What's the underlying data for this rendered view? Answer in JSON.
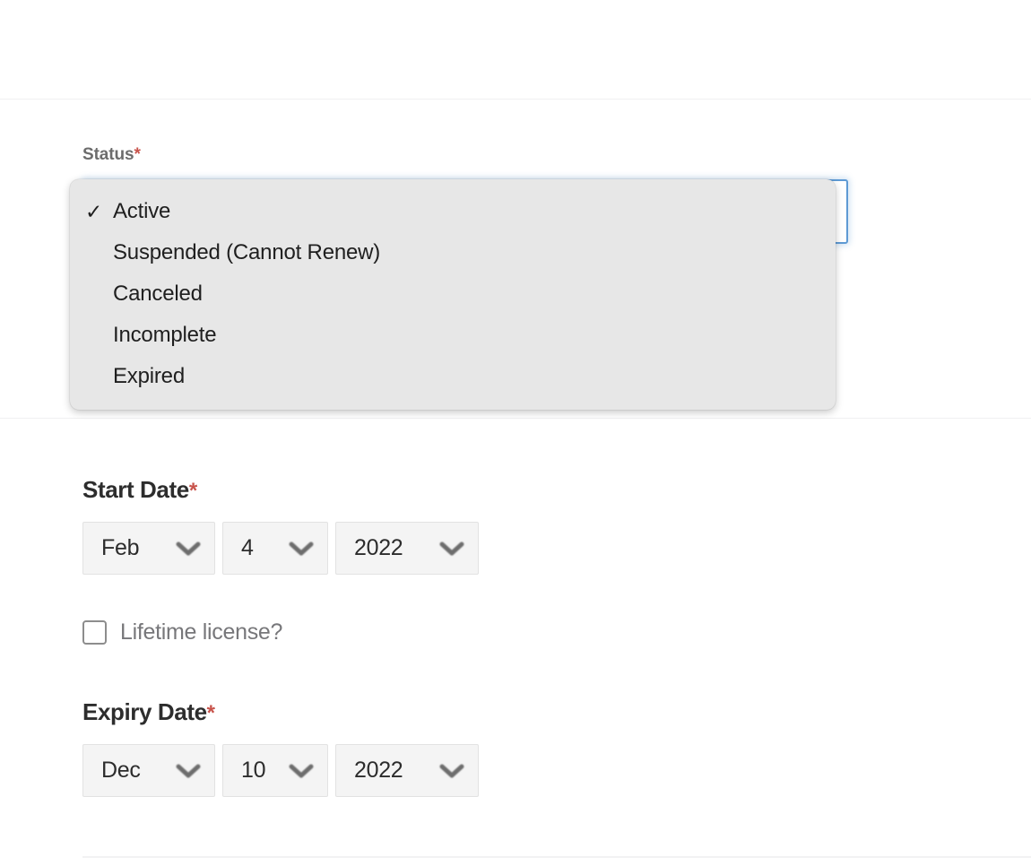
{
  "form": {
    "status": {
      "label": "Status",
      "required_marker": "*",
      "selected_value": "Active",
      "options": [
        {
          "label": "Active",
          "checked": true
        },
        {
          "label": "Suspended (Cannot Renew)",
          "checked": false
        },
        {
          "label": "Canceled",
          "checked": false
        },
        {
          "label": "Incomplete",
          "checked": false
        },
        {
          "label": "Expired",
          "checked": false
        }
      ],
      "check_glyph": "✓"
    },
    "start_date": {
      "label": "Start Date",
      "required_marker": "*",
      "month": "Feb",
      "day": "4",
      "year": "2022"
    },
    "lifetime_license": {
      "label": "Lifetime license?",
      "checked": false
    },
    "expiry_date": {
      "label": "Expiry Date",
      "required_marker": "*",
      "month": "Dec",
      "day": "10",
      "year": "2022"
    }
  },
  "colors": {
    "required_asterisk": "#c8534b",
    "focus_border": "#5e9ad4",
    "dropdown_bg": "#e7e7e7",
    "select_bg": "#f4f4f4",
    "heading_text": "#2d2d2d",
    "muted_text": "#6c6c6c"
  },
  "icons": {
    "chevron_down": "chevron-down-icon",
    "checkmark": "check-icon"
  }
}
